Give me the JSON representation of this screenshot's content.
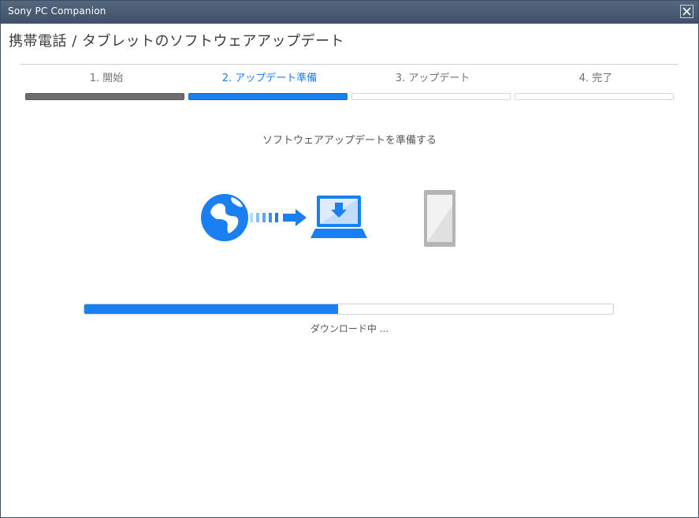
{
  "window": {
    "title": "Sony PC Companion"
  },
  "page": {
    "heading": "携帯電話 / タブレットのソフトウェアアップデート"
  },
  "steps": [
    {
      "label": "1. 開始",
      "state": "done"
    },
    {
      "label": "2. アップデート準備",
      "state": "active"
    },
    {
      "label": "3. アップデート",
      "state": "pending"
    },
    {
      "label": "4. 完了",
      "state": "pending"
    }
  ],
  "caption": "ソフトウェアアップデートを準備する",
  "icons": [
    "globe-icon",
    "transfer-arrow-icon",
    "laptop-download-icon",
    "phone-icon"
  ],
  "progress": {
    "fraction": 0.48,
    "status": "ダウンロード中 ..."
  },
  "colors": {
    "accent": "#1a7ff0",
    "done": "#6e6e6e",
    "titlebar": "#45566e"
  }
}
